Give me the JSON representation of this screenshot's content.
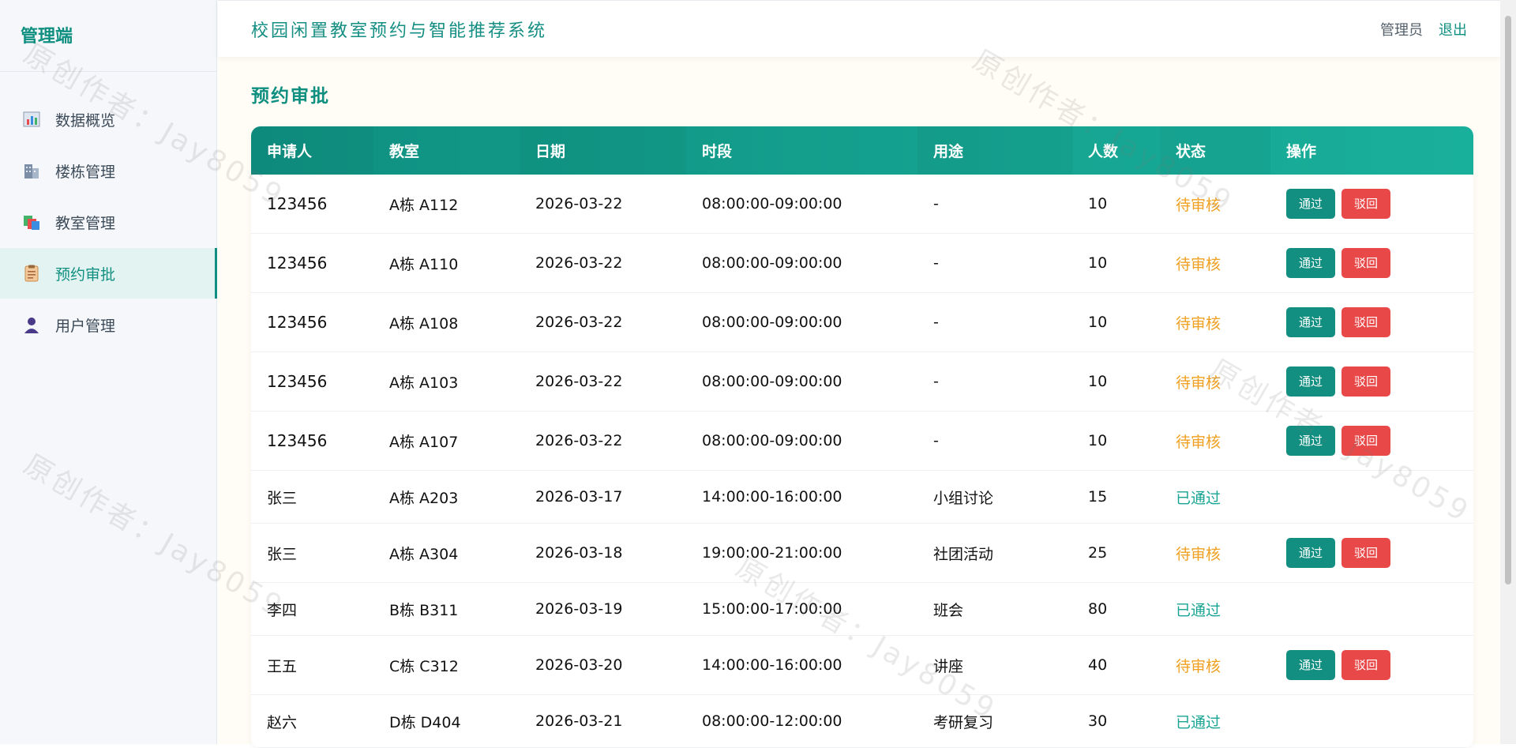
{
  "sidebar": {
    "brand": "管理端",
    "items": [
      {
        "label": "数据概览",
        "icon": "bar-chart-icon"
      },
      {
        "label": "楼栋管理",
        "icon": "building-icon"
      },
      {
        "label": "教室管理",
        "icon": "classroom-icon"
      },
      {
        "label": "预约审批",
        "icon": "clipboard-icon",
        "active": true
      },
      {
        "label": "用户管理",
        "icon": "user-icon"
      }
    ]
  },
  "header": {
    "title": "校园闲置教室预约与智能推荐系统",
    "role": "管理员",
    "logout": "退出"
  },
  "page": {
    "title": "预约审批"
  },
  "table": {
    "columns": [
      "申请人",
      "教室",
      "日期",
      "时段",
      "用途",
      "人数",
      "状态",
      "操作"
    ],
    "rows": [
      {
        "applicant": "123456",
        "room": "A栋 A112",
        "date": "2026-03-22",
        "time": "08:00:00-09:00:00",
        "purpose": "-",
        "count": "10",
        "status": "待审核",
        "pending": true
      },
      {
        "applicant": "123456",
        "room": "A栋 A110",
        "date": "2026-03-22",
        "time": "08:00:00-09:00:00",
        "purpose": "-",
        "count": "10",
        "status": "待审核",
        "pending": true
      },
      {
        "applicant": "123456",
        "room": "A栋 A108",
        "date": "2026-03-22",
        "time": "08:00:00-09:00:00",
        "purpose": "-",
        "count": "10",
        "status": "待审核",
        "pending": true
      },
      {
        "applicant": "123456",
        "room": "A栋 A103",
        "date": "2026-03-22",
        "time": "08:00:00-09:00:00",
        "purpose": "-",
        "count": "10",
        "status": "待审核",
        "pending": true
      },
      {
        "applicant": "123456",
        "room": "A栋 A107",
        "date": "2026-03-22",
        "time": "08:00:00-09:00:00",
        "purpose": "-",
        "count": "10",
        "status": "待审核",
        "pending": true
      },
      {
        "applicant": "张三",
        "room": "A栋 A203",
        "date": "2026-03-17",
        "time": "14:00:00-16:00:00",
        "purpose": "小组讨论",
        "count": "15",
        "status": "已通过",
        "pending": false
      },
      {
        "applicant": "张三",
        "room": "A栋 A304",
        "date": "2026-03-18",
        "time": "19:00:00-21:00:00",
        "purpose": "社团活动",
        "count": "25",
        "status": "待审核",
        "pending": true
      },
      {
        "applicant": "李四",
        "room": "B栋 B311",
        "date": "2026-03-19",
        "time": "15:00:00-17:00:00",
        "purpose": "班会",
        "count": "80",
        "status": "已通过",
        "pending": false
      },
      {
        "applicant": "王五",
        "room": "C栋 C312",
        "date": "2026-03-20",
        "time": "14:00:00-16:00:00",
        "purpose": "讲座",
        "count": "40",
        "status": "待审核",
        "pending": true
      },
      {
        "applicant": "赵六",
        "room": "D栋 D404",
        "date": "2026-03-21",
        "time": "08:00:00-12:00:00",
        "purpose": "考研复习",
        "count": "30",
        "status": "已通过",
        "pending": false
      }
    ],
    "approve_label": "通过",
    "reject_label": "驳回"
  },
  "watermark": "原创作者：Jay8059",
  "colors": {
    "accent": "#0f8f80",
    "pending": "#f0a020",
    "approved": "#17a493",
    "reject": "#e94848"
  }
}
